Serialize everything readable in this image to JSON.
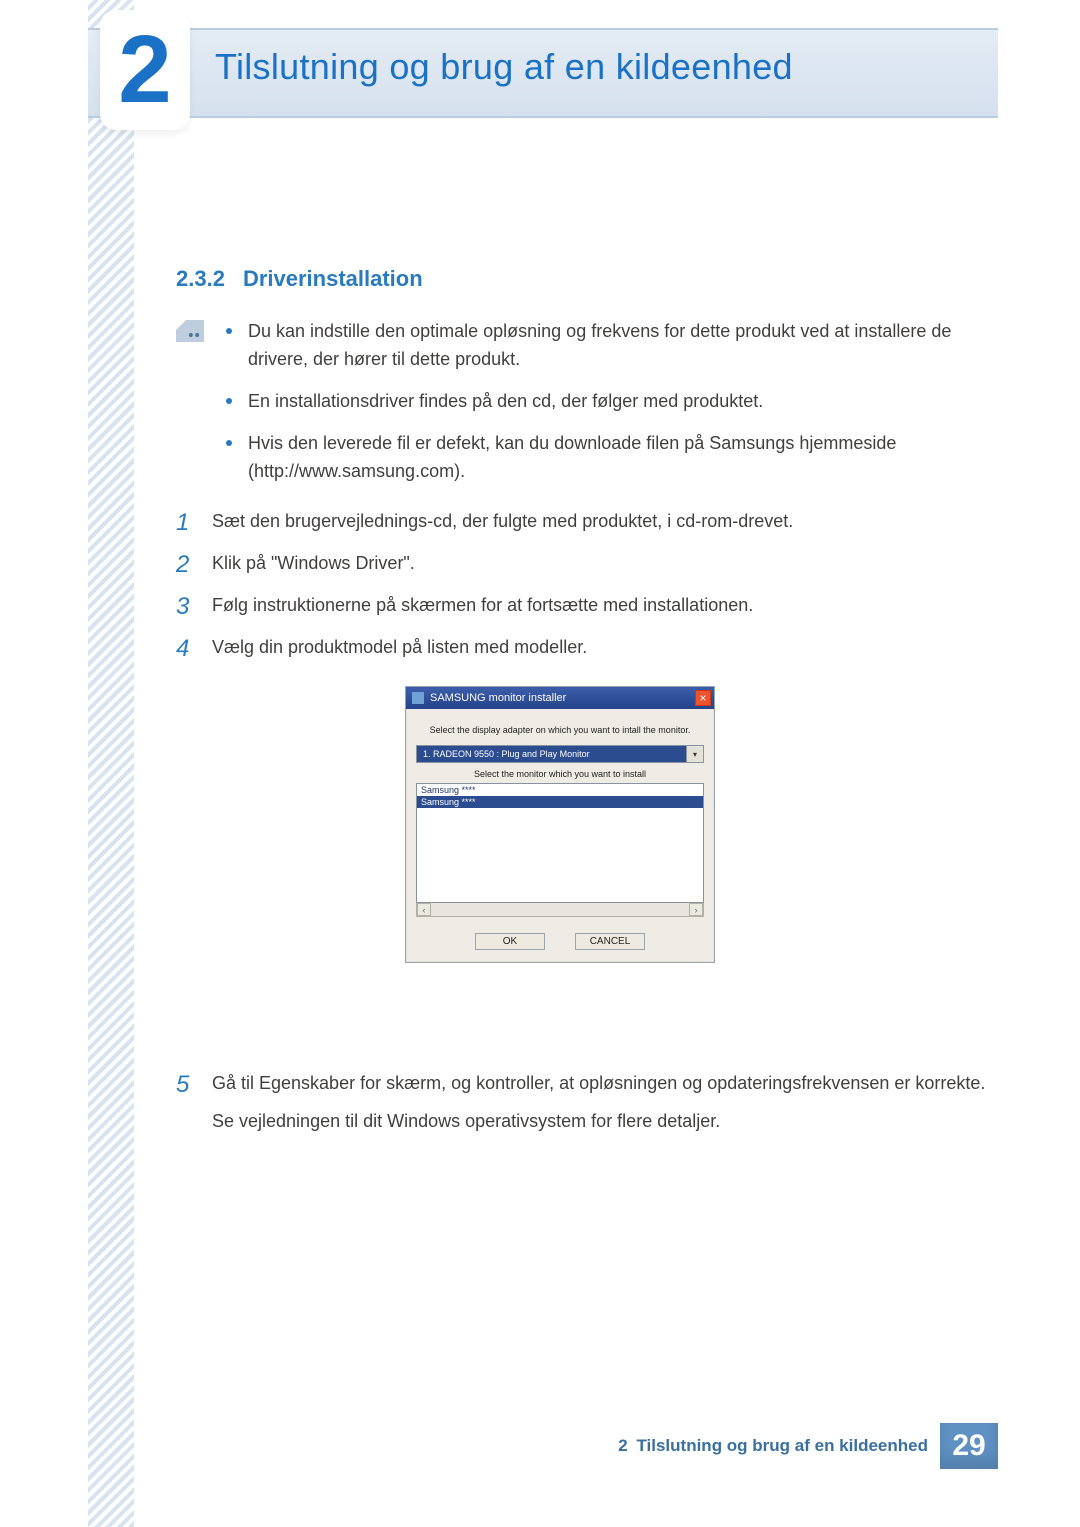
{
  "chapter": {
    "number": "2",
    "title": "Tilslutning og brug af en kildeenhed"
  },
  "section": {
    "number": "2.3.2",
    "title": "Driverinstallation"
  },
  "notes": [
    "Du kan indstille den optimale opløsning og frekvens for dette produkt ved at installere de drivere, der hører til dette produkt.",
    "En installationsdriver findes på den cd, der følger med produktet.",
    "Hvis den leverede fil er defekt, kan du downloade filen på Samsungs hjemmeside (http://www.samsung.com)."
  ],
  "steps": {
    "s1": {
      "n": "1",
      "text": "Sæt den brugervejlednings-cd, der fulgte med produktet, i cd-rom-drevet."
    },
    "s2": {
      "n": "2",
      "text": "Klik på \"Windows Driver\"."
    },
    "s3": {
      "n": "3",
      "text": "Følg instruktionerne på skærmen for at fortsætte med installationen."
    },
    "s4": {
      "n": "4",
      "text": "Vælg din produktmodel på listen med modeller."
    },
    "s5": {
      "n": "5",
      "line1": "Gå til Egenskaber for skærm, og kontroller, at opløsningen og opdateringsfrekvensen er korrekte.",
      "line2": "Se vejledningen til dit Windows operativsystem for flere detaljer."
    }
  },
  "dialog": {
    "title": "SAMSUNG monitor installer",
    "close": "×",
    "msg1": "Select the display adapter on which you want to intall the monitor.",
    "adapter": "1. RADEON 9550 : Plug and Play Monitor",
    "dropdownArrow": "▾",
    "msg2": "Select the monitor which you want to install",
    "list": {
      "row0": "Samsung ****",
      "row1": "Samsung ****"
    },
    "scrollLeft": "‹",
    "scrollRight": "›",
    "ok": "OK",
    "cancel": "CANCEL"
  },
  "footer": {
    "chapterNum": "2",
    "chapterTitle": "Tilslutning og brug af en kildeenhed",
    "pageNumber": "29"
  }
}
